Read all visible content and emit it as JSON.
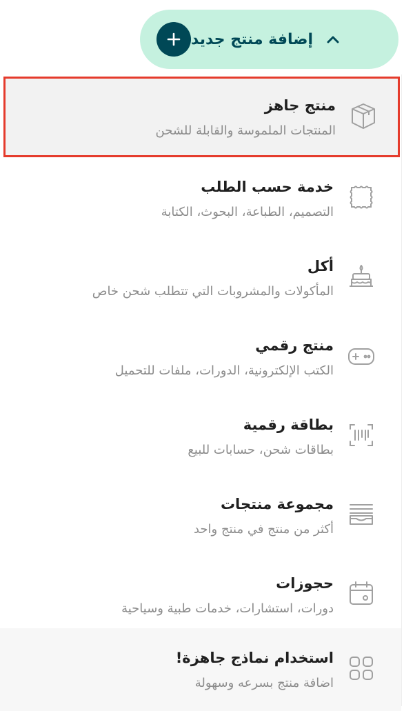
{
  "add_button": {
    "label": "إضافة منتج جديد",
    "icon": "plus-icon",
    "chevron": "chevron-up-icon"
  },
  "colors": {
    "accent_bg": "#c5f1df",
    "accent_dark": "#004856",
    "selection_border": "#e53b2c"
  },
  "menu": {
    "items": [
      {
        "title": "منتج جاهز",
        "subtitle": "المنتجات الملموسة والقابلة للشحن",
        "icon": "box-icon",
        "selected": true
      },
      {
        "title": "خدمة حسب الطلب",
        "subtitle": "التصميم، الطباعة، البحوث، الكتابة",
        "icon": "stamp-icon"
      },
      {
        "title": "أكل",
        "subtitle": "المأكولات والمشروبات التي تتطلب شحن خاص",
        "icon": "cake-icon"
      },
      {
        "title": "منتج رقمي",
        "subtitle": "الكتب الإلكترونية، الدورات، ملفات للتحميل",
        "icon": "gamepad-icon"
      },
      {
        "title": "بطاقة رقمية",
        "subtitle": "بطاقات شحن، حسابات للبيع",
        "icon": "barcode-icon"
      },
      {
        "title": "مجموعة منتجات",
        "subtitle": "أكثر من منتج في منتج واحد",
        "icon": "stack-icon"
      },
      {
        "title": "حجوزات",
        "subtitle": "دورات، استشارات، خدمات طبية وسياحية",
        "icon": "calendar-icon"
      }
    ],
    "footer": {
      "title": "استخدام نماذج جاهزة!",
      "subtitle": "اضافة منتج بسرعه وسهولة",
      "icon": "grid-icon"
    }
  }
}
